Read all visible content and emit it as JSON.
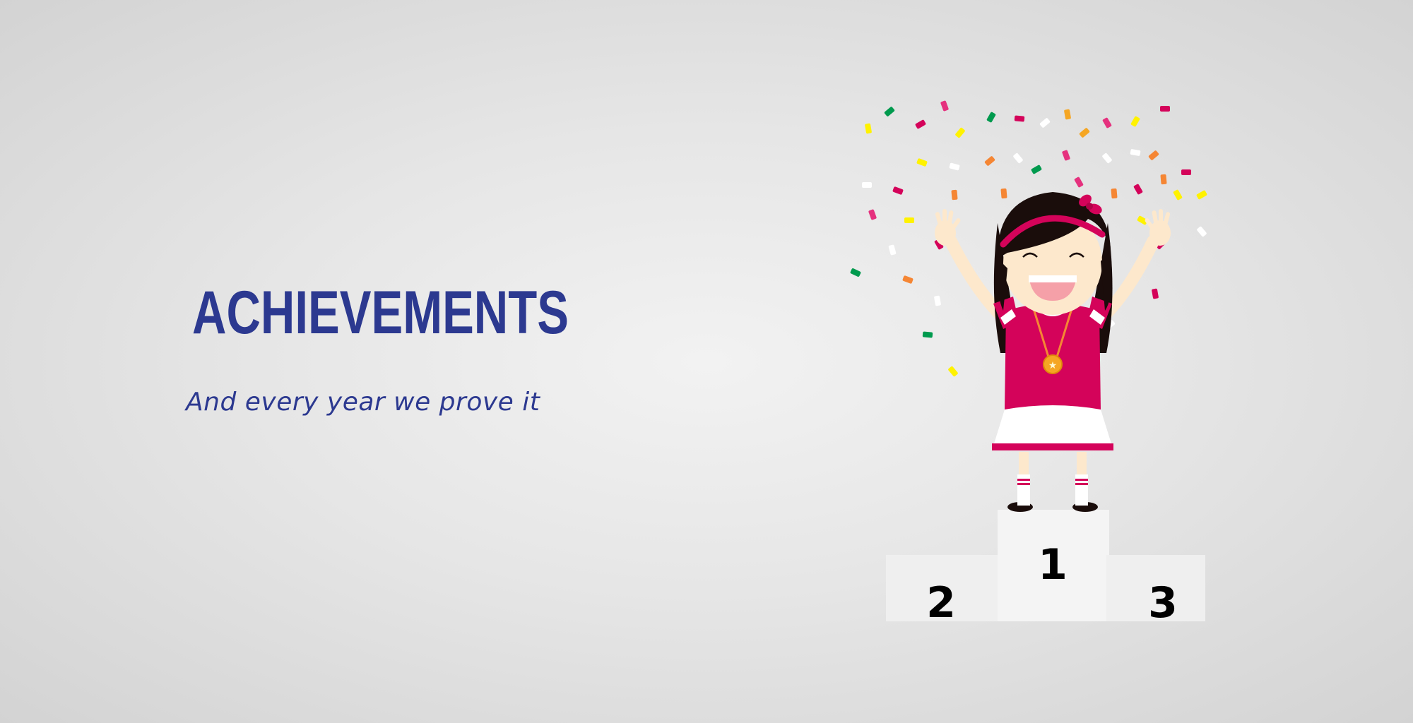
{
  "slide": {
    "title": "ACHIEVEMENTS",
    "subtitle": "And every year we prove it"
  },
  "podium": {
    "first": "1",
    "second": "2",
    "third": "3"
  },
  "colors": {
    "title": "#2c3990",
    "dress": "#d4035a",
    "podium": "#f0f0f0",
    "hair": "#1a0d0b",
    "skin": "#fde8cc",
    "medal": "#f5a623"
  },
  "icons": {
    "illustration": "celebrating-girl-on-winner-podium",
    "confetti": "confetti-icon",
    "medal": "gold-medal-icon"
  }
}
